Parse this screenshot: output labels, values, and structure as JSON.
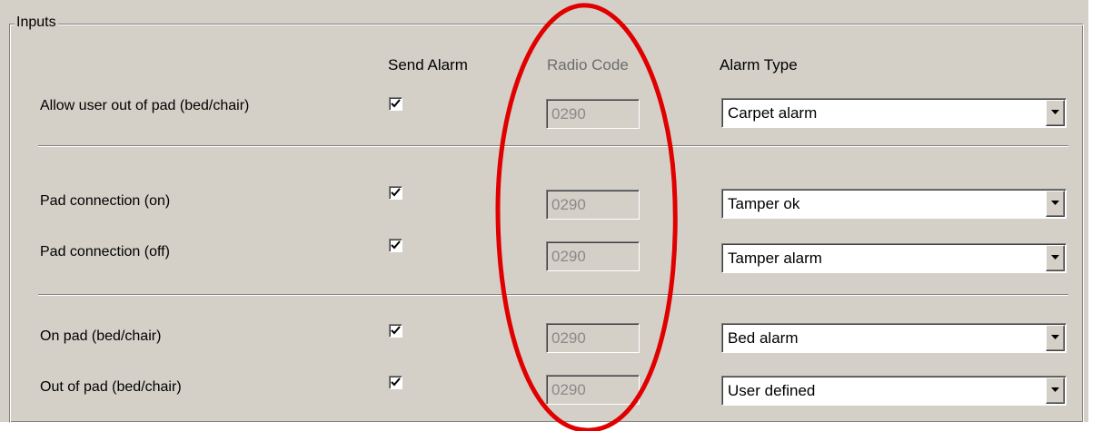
{
  "group": {
    "title": "Inputs"
  },
  "headers": {
    "send_alarm": "Send Alarm",
    "radio_code": "Radio Code",
    "alarm_type": "Alarm Type"
  },
  "rows": [
    {
      "label": "Allow user out of pad (bed/chair)",
      "send_alarm": true,
      "radio_code": "0290",
      "alarm_type": "Carpet alarm"
    },
    {
      "label": "Pad connection (on)",
      "send_alarm": true,
      "radio_code": "0290",
      "alarm_type": "Tamper ok"
    },
    {
      "label": "Pad connection (off)",
      "send_alarm": true,
      "radio_code": "0290",
      "alarm_type": "Tamper alarm"
    },
    {
      "label": "On pad (bed/chair)",
      "send_alarm": true,
      "radio_code": "0290",
      "alarm_type": "Bed alarm"
    },
    {
      "label": "Out of pad (bed/chair)",
      "send_alarm": true,
      "radio_code": "0290",
      "alarm_type": "User defined"
    }
  ],
  "icons": {
    "checkbox": "checkmark-icon",
    "dropdown": "triangle-down-icon"
  },
  "colors": {
    "panel": "#d4d0c8",
    "annotation": "#e00000",
    "disabled_text": "#8a8a8a"
  }
}
